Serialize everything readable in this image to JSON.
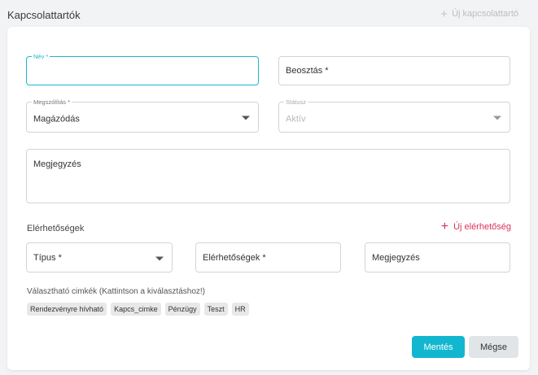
{
  "header": {
    "title": "Kapcsolattartók",
    "add_label": "Új kapcsolattartó"
  },
  "form": {
    "name": {
      "label": "Név *",
      "value": ""
    },
    "position": {
      "placeholder": "Beosztás *"
    },
    "salutation": {
      "label": "Megszólítás *",
      "value": "Magázódás"
    },
    "status": {
      "label": "Státusz",
      "value": "Aktív"
    },
    "note": {
      "placeholder": "Megjegyzés"
    }
  },
  "contacts": {
    "section_label": "Elérhetőségek",
    "add_label": "Új elérhetőség",
    "type_placeholder": "Típus *",
    "value_placeholder": "Elérhetőségek *",
    "note_placeholder": "Megjegyzés"
  },
  "tags": {
    "label": "Választható cimkék (Kattintson a kiválasztáshoz!)",
    "items": [
      "Rendezvényre hívható",
      "Kapcs_cimke",
      "Pénzügy",
      "Teszt",
      "HR"
    ]
  },
  "buttons": {
    "save": "Mentés",
    "cancel": "Mégse"
  },
  "colors": {
    "accent": "#12b7cf",
    "add_link": "#d6345a",
    "disabled_text": "#b8b8b8"
  }
}
